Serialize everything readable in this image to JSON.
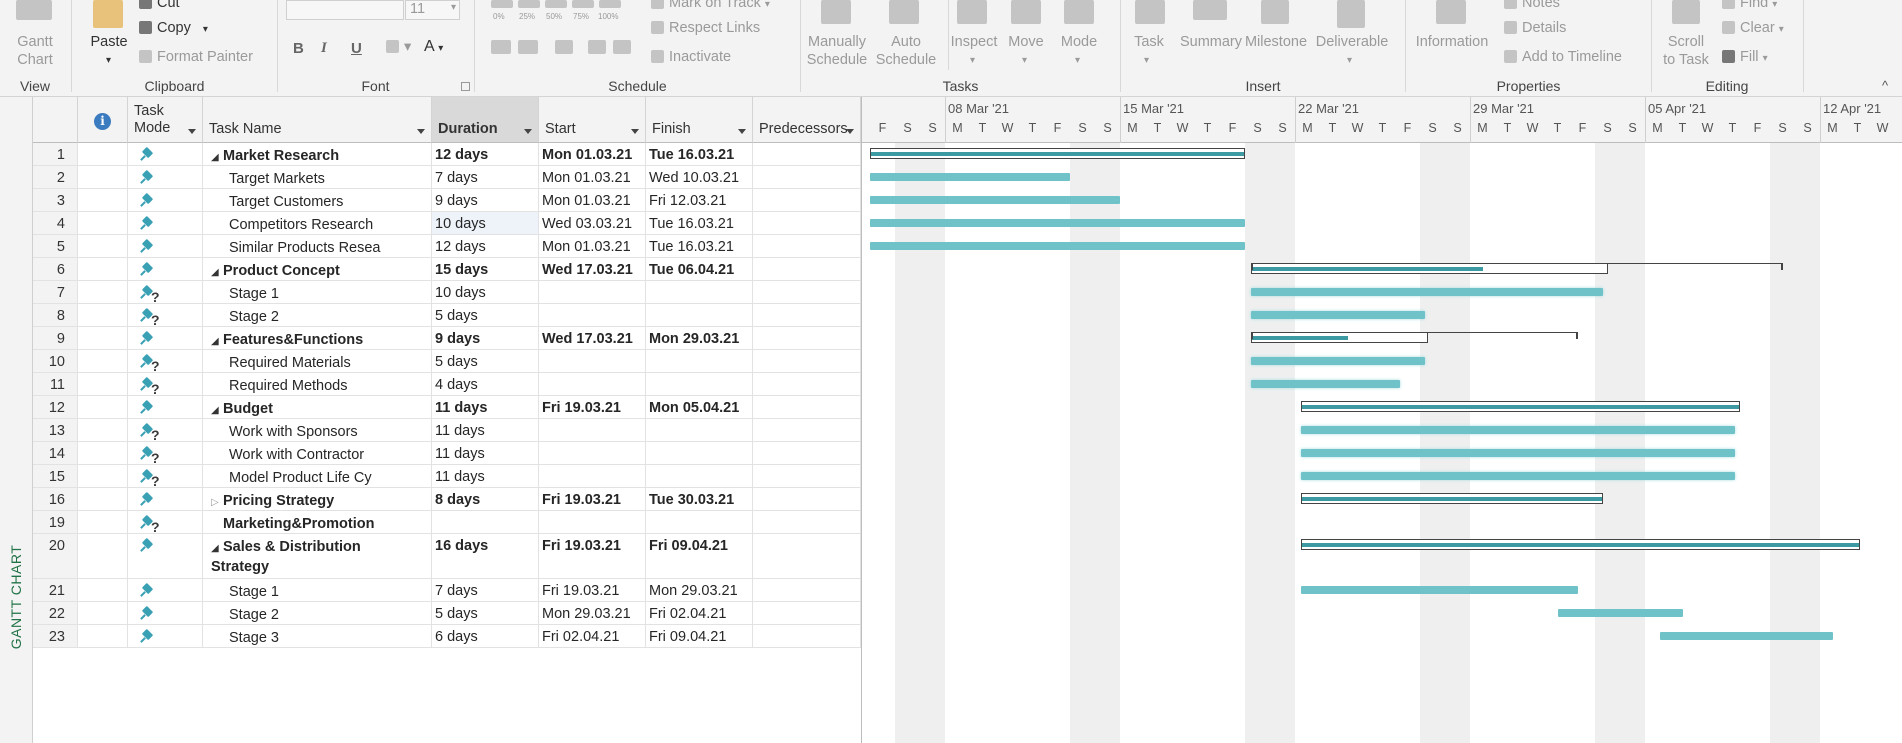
{
  "ribbon": {
    "view": {
      "gantt_chart": "Gantt\nChart",
      "group_label": "View"
    },
    "clipboard": {
      "paste": "Paste",
      "cut": "Cut",
      "copy": "Copy",
      "format_painter": "Format Painter",
      "group_label": "Clipboard"
    },
    "font": {
      "size_value": "11",
      "bold": "B",
      "italic": "I",
      "underline": "U",
      "group_label": "Font"
    },
    "schedule": {
      "pct_0": "0%",
      "pct_25": "25%",
      "pct_50": "50%",
      "pct_75": "75%",
      "pct_100": "100%",
      "mark_on_track": "Mark on Track",
      "respect_links": "Respect Links",
      "inactivate": "Inactivate",
      "group_label": "Schedule"
    },
    "tasks": {
      "manually_schedule": "Manually\nSchedule",
      "auto_schedule": "Auto\nSchedule",
      "inspect": "Inspect",
      "move": "Move",
      "mode": "Mode",
      "group_label": "Tasks"
    },
    "insert": {
      "task": "Task",
      "summary": "Summary",
      "milestone": "Milestone",
      "deliverable": "Deliverable",
      "group_label": "Insert"
    },
    "properties": {
      "information": "Information",
      "notes": "Notes",
      "details": "Details",
      "add_to_timeline": "Add to Timeline",
      "group_label": "Properties"
    },
    "editing": {
      "scroll_to_task": "Scroll\nto Task",
      "find": "Find",
      "clear": "Clear",
      "fill": "Fill",
      "group_label": "Editing"
    }
  },
  "sidebar": {
    "view_label": "GANTT CHART"
  },
  "table": {
    "columns": {
      "indicators": "i",
      "task_mode": "Task\nMode",
      "task_name": "Task Name",
      "duration": "Duration",
      "start": "Start",
      "finish": "Finish",
      "predecessors": "Predecessors"
    },
    "rows": [
      {
        "id": "1",
        "mode": "auto",
        "name": "Market Research",
        "duration": "12 days",
        "start": "Mon 01.03.21",
        "finish": "Tue 16.03.21",
        "summary": true,
        "level": 0,
        "expanded": true
      },
      {
        "id": "2",
        "mode": "auto",
        "name": "Target Markets",
        "duration": "7 days",
        "start": "Mon 01.03.21",
        "finish": "Wed 10.03.21",
        "summary": false,
        "level": 1
      },
      {
        "id": "3",
        "mode": "auto",
        "name": "Target Customers",
        "duration": "9 days",
        "start": "Mon 01.03.21",
        "finish": "Fri 12.03.21",
        "summary": false,
        "level": 1
      },
      {
        "id": "4",
        "mode": "auto",
        "name": "Competitors Research",
        "duration": "10 days",
        "start": "Wed 03.03.21",
        "finish": "Tue 16.03.21",
        "summary": false,
        "level": 1
      },
      {
        "id": "5",
        "mode": "auto",
        "name": "Similar Products Resea",
        "duration": "12 days",
        "start": "Mon 01.03.21",
        "finish": "Tue 16.03.21",
        "summary": false,
        "level": 1
      },
      {
        "id": "6",
        "mode": "auto",
        "name": "Product Concept",
        "duration": "15 days",
        "start": "Wed 17.03.21",
        "finish": "Tue 06.04.21",
        "summary": true,
        "level": 0,
        "expanded": true
      },
      {
        "id": "7",
        "mode": "manual",
        "name": "Stage 1",
        "duration": "10 days",
        "start": "",
        "finish": "",
        "summary": false,
        "level": 1
      },
      {
        "id": "8",
        "mode": "manual",
        "name": "Stage 2",
        "duration": "5 days",
        "start": "",
        "finish": "",
        "summary": false,
        "level": 1
      },
      {
        "id": "9",
        "mode": "auto",
        "name": "Features&Functions",
        "duration": "9 days",
        "start": "Wed 17.03.21",
        "finish": "Mon 29.03.21",
        "summary": true,
        "level": 0,
        "expanded": true
      },
      {
        "id": "10",
        "mode": "manual",
        "name": "Required Materials",
        "duration": "5 days",
        "start": "",
        "finish": "",
        "summary": false,
        "level": 1
      },
      {
        "id": "11",
        "mode": "manual",
        "name": "Required Methods",
        "duration": "4 days",
        "start": "",
        "finish": "",
        "summary": false,
        "level": 1
      },
      {
        "id": "12",
        "mode": "auto",
        "name": "Budget",
        "duration": "11 days",
        "start": "Fri 19.03.21",
        "finish": "Mon 05.04.21",
        "summary": true,
        "level": 0,
        "expanded": true
      },
      {
        "id": "13",
        "mode": "manual",
        "name": "Work with Sponsors",
        "duration": "11 days",
        "start": "",
        "finish": "",
        "summary": false,
        "level": 1
      },
      {
        "id": "14",
        "mode": "manual",
        "name": "Work with Contractor",
        "duration": "11 days",
        "start": "",
        "finish": "",
        "summary": false,
        "level": 1
      },
      {
        "id": "15",
        "mode": "manual",
        "name": "Model Product Life Cy",
        "duration": "11 days",
        "start": "",
        "finish": "",
        "summary": false,
        "level": 1
      },
      {
        "id": "16",
        "mode": "auto",
        "name": "Pricing Strategy",
        "duration": "8 days",
        "start": "Fri 19.03.21",
        "finish": "Tue 30.03.21",
        "summary": true,
        "level": 0,
        "expanded": false
      },
      {
        "id": "19",
        "mode": "manual",
        "name": "Marketing&Promotion",
        "duration": "",
        "start": "",
        "finish": "",
        "summary": true,
        "level": 0
      },
      {
        "id": "20",
        "mode": "auto",
        "name": "Sales & Distribution\nStrategy",
        "duration": "16 days",
        "start": "Fri 19.03.21",
        "finish": "Fri 09.04.21",
        "summary": true,
        "level": 0,
        "expanded": true,
        "tall": true
      },
      {
        "id": "21",
        "mode": "auto",
        "name": "Stage 1",
        "duration": "7 days",
        "start": "Fri 19.03.21",
        "finish": "Mon 29.03.21",
        "summary": false,
        "level": 1
      },
      {
        "id": "22",
        "mode": "auto",
        "name": "Stage 2",
        "duration": "5 days",
        "start": "Mon 29.03.21",
        "finish": "Fri 02.04.21",
        "summary": false,
        "level": 1
      },
      {
        "id": "23",
        "mode": "auto",
        "name": "Stage 3",
        "duration": "6 days",
        "start": "Fri 02.04.21",
        "finish": "Fri 09.04.21",
        "summary": false,
        "level": 1
      }
    ]
  },
  "gantt": {
    "weeks": [
      "08 Mar '21",
      "15 Mar '21",
      "22 Mar '21",
      "29 Mar '21",
      "05 Apr '21",
      "12 Apr '21"
    ],
    "day_letters": [
      "F",
      "S",
      "S",
      "M",
      "T",
      "W",
      "T",
      "F",
      "S",
      "S",
      "M",
      "T",
      "W",
      "T",
      "F",
      "S",
      "S",
      "M",
      "T",
      "W",
      "T",
      "F",
      "S",
      "S",
      "M",
      "T",
      "W",
      "T",
      "F",
      "S",
      "S",
      "M",
      "T",
      "W",
      "T",
      "F",
      "S",
      "S",
      "M",
      "T",
      "W",
      "T"
    ],
    "bars": [
      {
        "row": 0,
        "kind": "summary",
        "from": -3,
        "to": 12,
        "done": 1.0
      },
      {
        "row": 1,
        "kind": "task",
        "from": -3,
        "to": 5
      },
      {
        "row": 2,
        "kind": "task",
        "from": -3,
        "to": 7
      },
      {
        "row": 3,
        "kind": "task",
        "from": -3,
        "to": 12
      },
      {
        "row": 4,
        "kind": "task",
        "from": -3,
        "to": 12
      },
      {
        "row": 5,
        "kind": "summary",
        "from": 12.25,
        "to": 26.5,
        "done": 0.65,
        "bracket_to": 33.5
      },
      {
        "row": 6,
        "kind": "manual",
        "from": 12.25,
        "to": 26.3
      },
      {
        "row": 7,
        "kind": "manual",
        "from": 12.25,
        "to": 19.2
      },
      {
        "row": 8,
        "kind": "summary",
        "from": 12.25,
        "to": 19.3,
        "done": 0.55,
        "bracket_to": 25.3
      },
      {
        "row": 9,
        "kind": "manual",
        "from": 12.25,
        "to": 19.2
      },
      {
        "row": 10,
        "kind": "manual",
        "from": 12.25,
        "to": 18.2
      },
      {
        "row": 11,
        "kind": "summary",
        "from": 14.25,
        "to": 31.8,
        "done": 1.0
      },
      {
        "row": 12,
        "kind": "manual",
        "from": 14.25,
        "to": 31.6
      },
      {
        "row": 13,
        "kind": "manual",
        "from": 14.25,
        "to": 31.6
      },
      {
        "row": 14,
        "kind": "manual",
        "from": 14.25,
        "to": 31.6
      },
      {
        "row": 15,
        "kind": "summary",
        "from": 14.25,
        "to": 26.3,
        "done": 1.0
      },
      {
        "row": 17,
        "kind": "summary",
        "from": 14.25,
        "to": 36.6,
        "done": 1.0
      },
      {
        "row": 18,
        "kind": "task",
        "from": 14.25,
        "to": 25.3
      },
      {
        "row": 19,
        "kind": "task",
        "from": 24.5,
        "to": 29.5
      },
      {
        "row": 20,
        "kind": "task",
        "from": 28.6,
        "to": 35.5
      }
    ]
  }
}
